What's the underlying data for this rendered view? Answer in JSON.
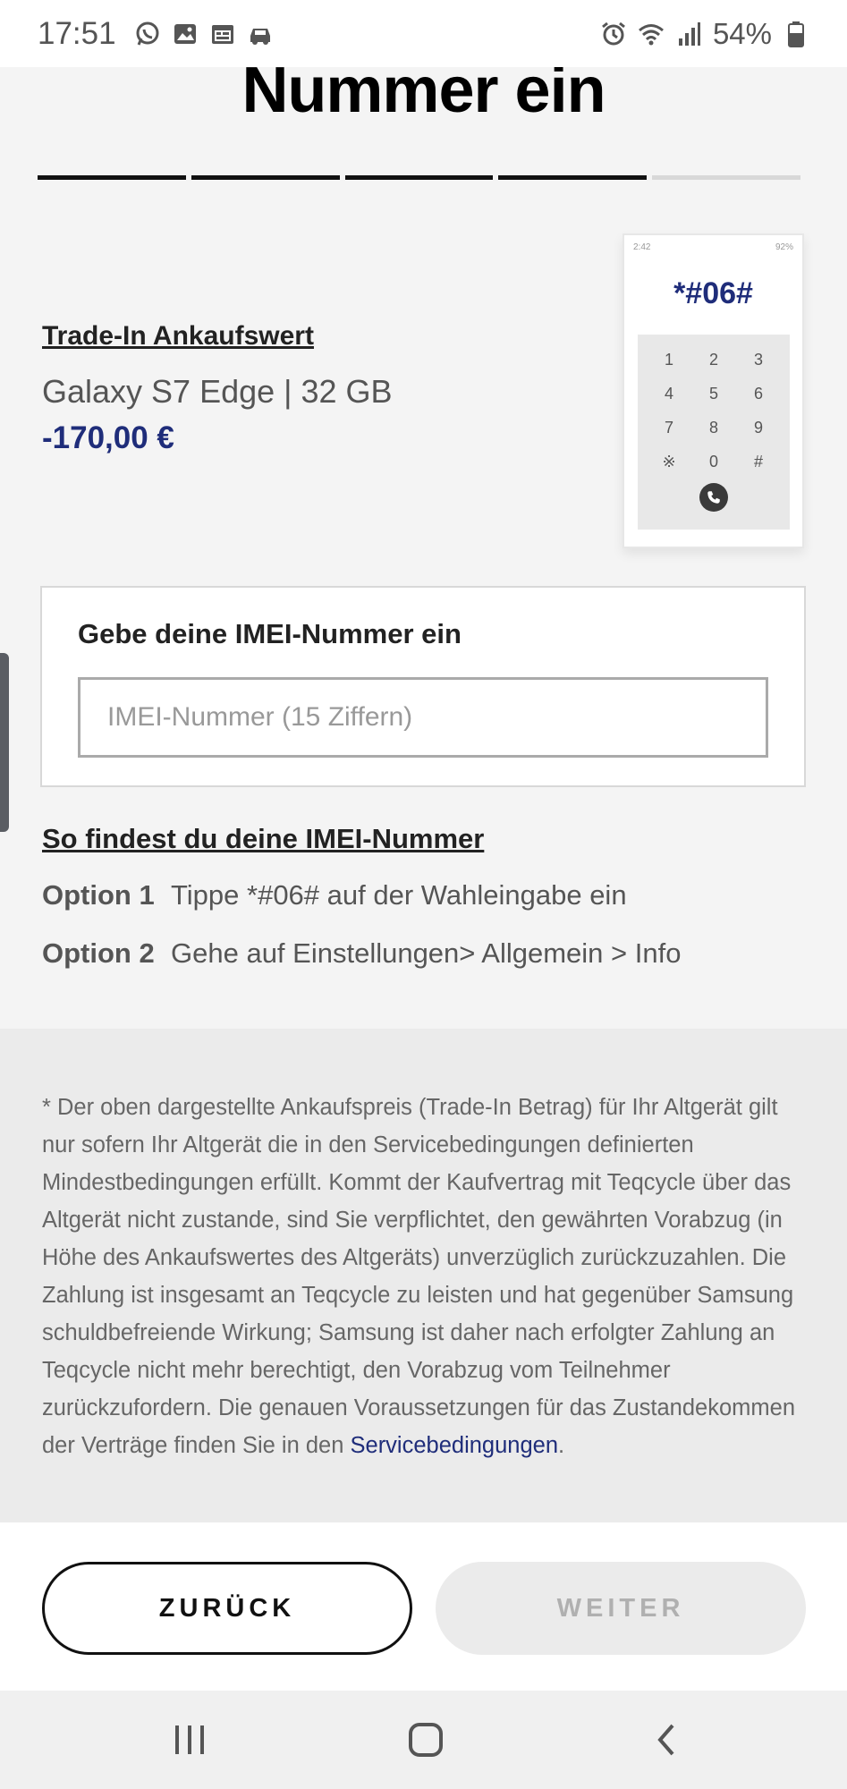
{
  "status_bar": {
    "time": "17:51",
    "battery": "54%",
    "left_icons": [
      "whatsapp-icon",
      "gallery-icon",
      "calendar-icon",
      "car-icon"
    ],
    "right_icons": [
      "alarm-icon",
      "wifi-icon",
      "signal-icon",
      "battery-icon"
    ]
  },
  "page": {
    "title": "Nummer ein",
    "progress": {
      "total_steps": 5,
      "completed_steps": 4
    }
  },
  "tradein": {
    "label": "Trade-In Ankaufswert",
    "device": "Galaxy S7 Edge | 32 GB",
    "value": "-170,00 €"
  },
  "phone_illustration": {
    "time": "2:42",
    "status": "92%",
    "code": "*#06#",
    "keys": [
      "1",
      "2",
      "3",
      "4",
      "5",
      "6",
      "7",
      "8",
      "9",
      "※",
      "0",
      "#"
    ]
  },
  "imei": {
    "label": "Gebe deine IMEI-Nummer ein",
    "placeholder": "IMEI-Nummer (15 Ziffern)",
    "value": ""
  },
  "howto": {
    "link": "So findest du deine IMEI-Nummer",
    "options": [
      {
        "label": "Option 1",
        "text": "Tippe *#06# auf der Wahleingabe ein"
      },
      {
        "label": "Option 2",
        "text": "Gehe auf Einstellungen> Allgemein > Info"
      }
    ]
  },
  "disclaimer": {
    "text": "* Der oben dargestellte Ankaufspreis (Trade-In Betrag) für Ihr Altgerät gilt nur sofern Ihr Altgerät die in den Servicebedingungen definierten Mindestbedingungen erfüllt. Kommt der Kaufvertrag mit Teqcycle über das Altgerät nicht zustande, sind Sie verpflichtet, den gewährten Vorabzug (in Höhe des Ankaufswertes des Altgeräts) unverzüglich zurückzuzahlen. Die Zahlung ist insgesamt an Teqcycle zu leisten und hat gegenüber Samsung schuldbefreiende Wirkung; Samsung ist daher nach erfolgter Zahlung an Teqcycle nicht mehr berechtigt, den Vorabzug vom Teilnehmer zurückzufordern. Die genauen Voraussetzungen für das Zustandekommen der Verträge finden Sie in den ",
    "link": "Servicebedingungen",
    "suffix": "."
  },
  "buttons": {
    "back": "ZURÜCK",
    "next": "WEITER"
  },
  "nav": {
    "icons": [
      "recent-apps-icon",
      "home-icon",
      "back-icon"
    ]
  },
  "colors": {
    "accent": "#1f2d7a",
    "text": "#333333",
    "muted": "#666666"
  }
}
